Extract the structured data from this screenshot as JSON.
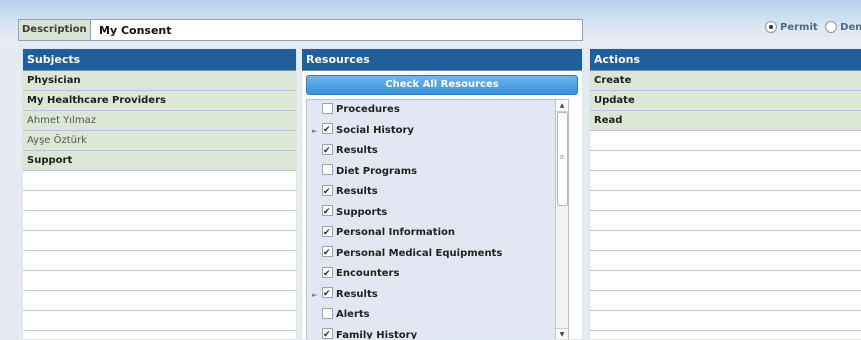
{
  "description": {
    "label": "Description",
    "value": "My Consent"
  },
  "decision": {
    "options": [
      {
        "label": "Permit",
        "selected": true
      },
      {
        "label": "Deny",
        "selected": false
      }
    ]
  },
  "subjects": {
    "title": "Subjects",
    "items": [
      {
        "label": "Physician",
        "style": "bold"
      },
      {
        "label": "My Healthcare Providers",
        "style": "bold"
      },
      {
        "label": "Ahmet Yılmaz",
        "style": "light"
      },
      {
        "label": "Ayşe Öztürk",
        "style": "light"
      },
      {
        "label": "Support",
        "style": "bold"
      }
    ],
    "empty_rows": 8
  },
  "resources": {
    "title": "Resources",
    "check_all_label": "Check All Resources",
    "items": [
      {
        "label": "Procedures",
        "checked": false,
        "expandable": false
      },
      {
        "label": "Social History",
        "checked": true,
        "expandable": true
      },
      {
        "label": "Results",
        "checked": true,
        "expandable": false
      },
      {
        "label": "Diet Programs",
        "checked": false,
        "expandable": false
      },
      {
        "label": "Results",
        "checked": true,
        "expandable": false
      },
      {
        "label": "Supports",
        "checked": true,
        "expandable": false
      },
      {
        "label": "Personal Information",
        "checked": true,
        "expandable": false
      },
      {
        "label": "Personal Medical Equipments",
        "checked": true,
        "expandable": false
      },
      {
        "label": "Encounters",
        "checked": true,
        "expandable": false
      },
      {
        "label": "Results",
        "checked": true,
        "expandable": true
      },
      {
        "label": "Alerts",
        "checked": false,
        "expandable": false
      },
      {
        "label": "Family History",
        "checked": true,
        "expandable": false
      }
    ]
  },
  "actions": {
    "title": "Actions",
    "items": [
      {
        "label": "Create"
      },
      {
        "label": "Update"
      },
      {
        "label": "Read"
      }
    ],
    "empty_rows": 10
  },
  "icons": {
    "expand": "expand-arrow-icon",
    "checkbox": "checkbox-icon",
    "scroll_up": "scroll-up-icon",
    "scroll_down": "scroll-down-icon"
  },
  "colors": {
    "header_bg": "#1f5f9c",
    "row_fill": "#dce6d4",
    "button_bg": "#3a8fd8",
    "list_bg": "#e3e7f4"
  }
}
